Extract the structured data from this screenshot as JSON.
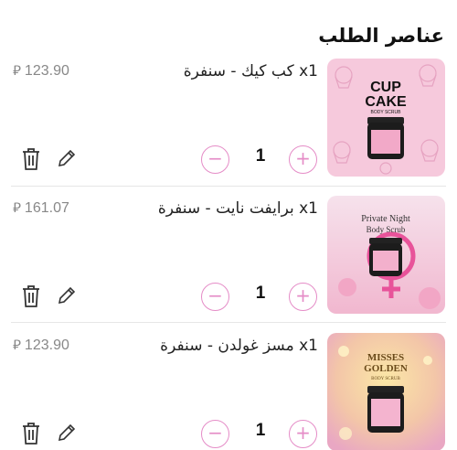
{
  "section": {
    "title": "عناصر الطلب"
  },
  "items": [
    {
      "qty": "x1",
      "name": "كب كيك - سنفرة",
      "price": "123.90",
      "currency": "⃁",
      "quantity": "1",
      "image_text": [
        "CUP",
        "CAKE",
        "BODY SCRUB"
      ],
      "minus": "−",
      "plus": "+"
    },
    {
      "qty": "x1",
      "name": "برايفت نايت - سنفرة",
      "price": "161.07",
      "currency": "⃁",
      "quantity": "1",
      "image_text": [
        "Private Night",
        "Body Scrub"
      ],
      "minus": "−",
      "plus": "+"
    },
    {
      "qty": "x1",
      "name": "مسز غولدن - سنفرة",
      "price": "123.90",
      "currency": "⃁",
      "quantity": "1",
      "image_text": [
        "MISSES",
        "GOLDEN",
        "BODY SCRUB"
      ],
      "minus": "−",
      "plus": "+"
    }
  ],
  "colors": {
    "accent": "#e58cc7",
    "divider": "#e6e6e6"
  }
}
